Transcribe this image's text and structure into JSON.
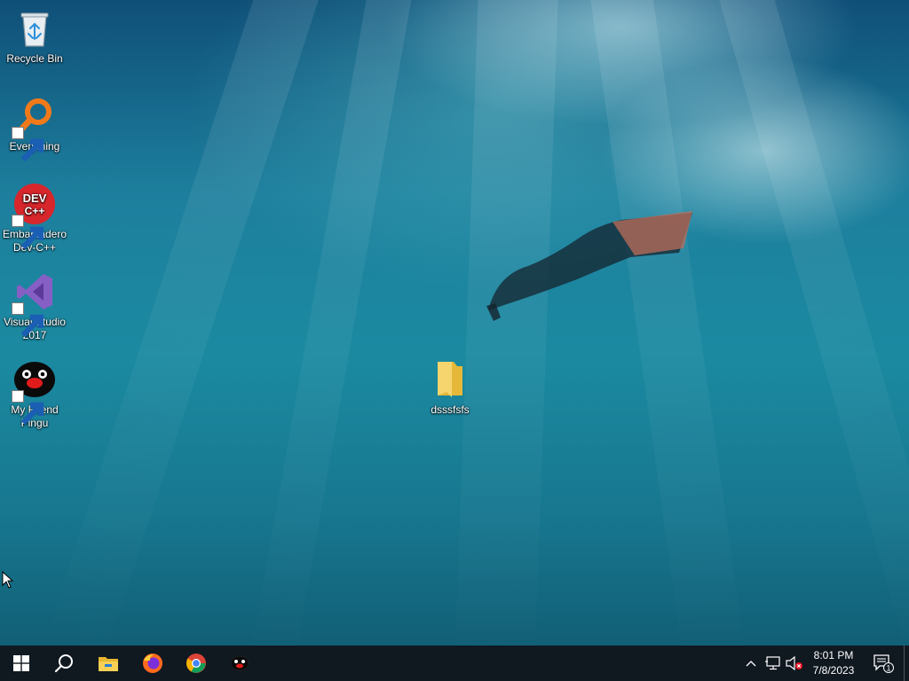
{
  "desktop": {
    "icons": [
      {
        "label": "Recycle Bin",
        "icon": "recycle-bin-icon"
      },
      {
        "label": "Everything",
        "icon": "everything-search-icon"
      },
      {
        "label": "Embarcadero Dev-C++",
        "icon": "devcpp-icon",
        "badge_text": "DEV C++"
      },
      {
        "label": "Visual Studio 2017",
        "icon": "visual-studio-icon"
      },
      {
        "label": "My Friend Pingu",
        "icon": "pingu-icon"
      },
      {
        "label": "dsssfsfs",
        "icon": "folder-icon"
      }
    ]
  },
  "taskbar": {
    "buttons": [
      {
        "name": "start",
        "icon": "windows-logo-icon"
      },
      {
        "name": "search",
        "icon": "search-icon"
      },
      {
        "name": "file-explorer",
        "icon": "file-explorer-icon"
      },
      {
        "name": "firefox",
        "icon": "firefox-icon"
      },
      {
        "name": "chrome",
        "icon": "chrome-icon"
      },
      {
        "name": "pingu",
        "icon": "pingu-icon"
      }
    ],
    "tray": {
      "icons": [
        "chevron-up-icon",
        "network-icon",
        "volume-muted-icon"
      ],
      "time": "8:01 PM",
      "date": "7/8/2023",
      "notification_count": "1"
    }
  },
  "colors": {
    "taskbar": "#101820",
    "water_deep": "#0f4f78",
    "water_mid": "#1b8aa1",
    "folder": "#f0c94e"
  }
}
